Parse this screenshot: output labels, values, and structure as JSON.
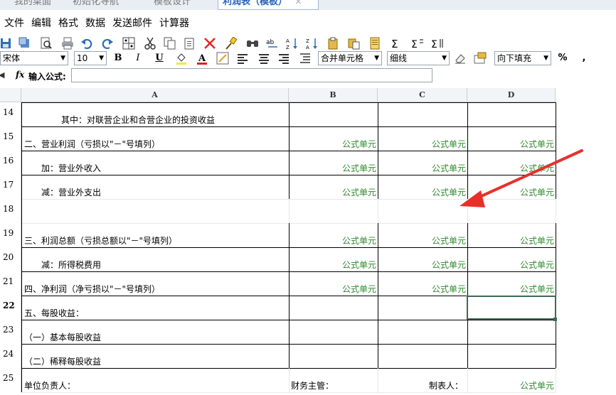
{
  "tabs": [
    {
      "label": "我的桌面"
    },
    {
      "label": "初始化导航"
    },
    {
      "label": "模板设计"
    },
    {
      "label": "利润表（模板）",
      "close": "×"
    }
  ],
  "menu": [
    "文件",
    "编辑",
    "格式",
    "数据",
    "发送邮件",
    "计算器"
  ],
  "toolbar": {
    "icons": [
      "save-icon",
      "save-as-icon",
      "print-preview-icon",
      "print-icon",
      "undo-icon",
      "redo-icon",
      "table-icon",
      "cut-icon",
      "copy-icon",
      "paste-icon",
      "delete-icon",
      "format-brush-icon",
      "find-icon",
      "replace-icon",
      "sort-asc-icon",
      "sort-desc-icon",
      "paste-special-icon",
      "clipboard-icon",
      "document-icon",
      "sum-icon",
      "row-sum-icon",
      "column-sum-icon"
    ]
  },
  "format_bar": {
    "font": "宋体",
    "size": "10",
    "bold": "B",
    "italic": "I",
    "underline": "U",
    "merge": "合并单元格",
    "border": "细线",
    "fill": "向下填充",
    "percent": "%",
    "comma": ","
  },
  "formula_bar": {
    "fx": "fx",
    "label": "输入公式:",
    "value": ""
  },
  "sheet": {
    "columns": [
      "A",
      "B",
      "C",
      "D"
    ],
    "rows": [
      {
        "num": "14",
        "a": "其中：对联营企业和合营企业的投资收益",
        "b": "",
        "c": "",
        "d": ""
      },
      {
        "num": "15",
        "a": "二、营业利润（亏损以\"－\"号填列）",
        "b": "公式单元",
        "c": "公式单元",
        "d": "公式单元"
      },
      {
        "num": "16",
        "a": "加：营业外收入",
        "b": "公式单元",
        "c": "公式单元",
        "d": "公式单元"
      },
      {
        "num": "17",
        "a": "减：营业外支出",
        "b": "公式单元",
        "c": "公式单元",
        "d": "公式单元"
      },
      {
        "num": "18",
        "a": "",
        "b": "",
        "c": "",
        "d": ""
      },
      {
        "num": "19",
        "a": "三、利润总额（亏损总额以\"－\"号填列）",
        "b": "公式单元",
        "c": "公式单元",
        "d": "公式单元"
      },
      {
        "num": "20",
        "a": "减：所得税费用",
        "b": "公式单元",
        "c": "公式单元",
        "d": "公式单元"
      },
      {
        "num": "21",
        "a": "四、净利润（净亏损以\"－\"号填列）",
        "b": "公式单元",
        "c": "公式单元",
        "d": "公式单元"
      },
      {
        "num": "22",
        "a": "五、每股收益：",
        "b": "",
        "c": "",
        "d": ""
      },
      {
        "num": "23",
        "a": "（一）基本每股收益",
        "b": "",
        "c": "",
        "d": ""
      },
      {
        "num": "24",
        "a": "（二）稀释每股收益",
        "b": "",
        "c": "",
        "d": ""
      },
      {
        "num": "25",
        "a": "单位负责人：",
        "b": "财务主管：",
        "c": "制表人：",
        "d": "公式单元"
      }
    ]
  },
  "colors": {
    "formula_text": "#2e8b2e",
    "annotation_arrow": "#e8302a",
    "selection": "#3d6b4e"
  }
}
